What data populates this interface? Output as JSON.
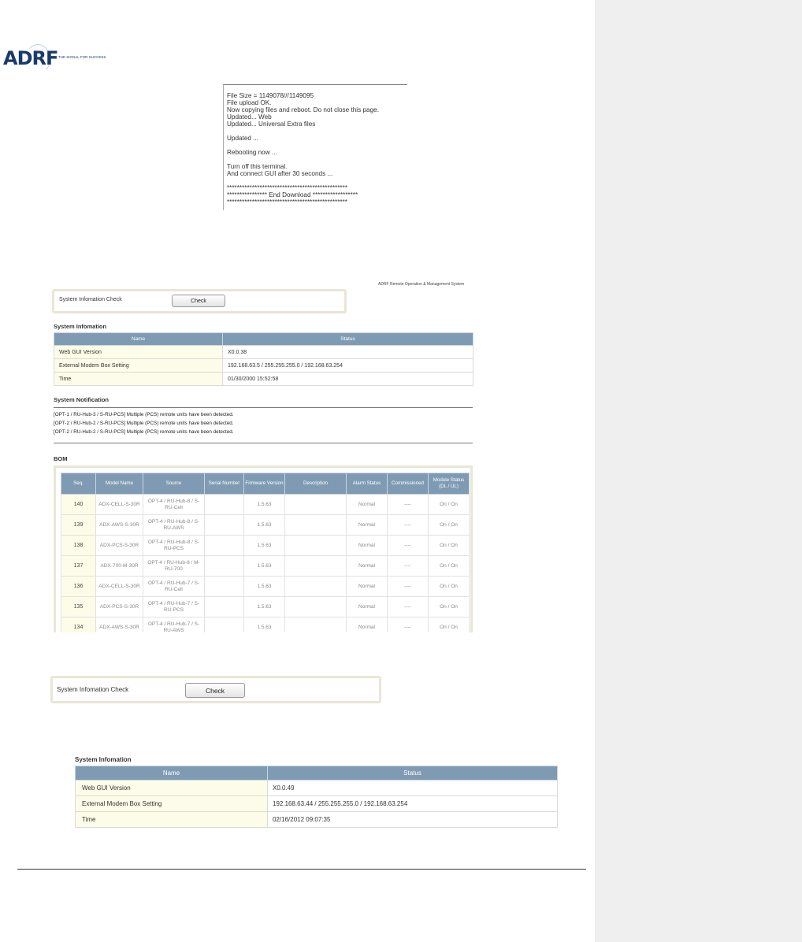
{
  "logo": {
    "brand": "ADRF",
    "tagline": "THE SIGNAL FOR SUCCESS"
  },
  "log": [
    "File Size = 1149078///1149095",
    "File upload OK.",
    "Now copying files and reboot. Do not close this page.",
    "Updated... Web",
    "Updated... Universal Extra files",
    "",
    "Updated ...",
    "",
    "Rebooting now ...",
    "",
    "Turn off this terminal.",
    "And connect GUI after 30 seconds ...",
    "",
    "************************************************",
    "**************** End Download ******************",
    "************************************************"
  ],
  "screen1": {
    "header_right": "ADRF Remote Operation & Management System",
    "check_label": "System Infomation Check",
    "check_button": "Check",
    "sysinfo_title": "System Infomation",
    "col_name": "Name",
    "col_status": "Status",
    "rows": [
      {
        "name": "Web GUI Version",
        "status": "X0.0.38"
      },
      {
        "name": "External Modem Box Setting",
        "status": "192.168.63.5 / 255.255.255.0 / 192.168.63.254"
      },
      {
        "name": "Time",
        "status": "01/30/2000 15:52:58"
      }
    ],
    "notification_title": "System Notification",
    "notifications": [
      "[OPT-1 / RU-Hub-3 / S-RU-PCS] Multiple (PCS) remote units have been detected.",
      "[OPT-2 / RU-Hub-2 / S-RU-PCS] Multiple (PCS) remote units have been detected.",
      "[OPT-2 / RU-Hub-2 / S-RU-PCS] Multiple (PCS) remote units have been detected."
    ],
    "bom_title": "BOM",
    "bom_headers": [
      "Seq.",
      "Model Name",
      "Source",
      "Serial Number",
      "Firmware Version",
      "Description",
      "Alarm Status",
      "Commissioned",
      "Module Status (DL / UL)"
    ],
    "bom_rows": [
      {
        "seq": "140",
        "model": "ADX-CELL-S-30R",
        "source": "OPT-4 / RU-Hub-8 / S-RU-Cell",
        "serial": "",
        "fw": "1.5.63",
        "desc": "",
        "alarm": "Normal",
        "comm": "----",
        "module": "On / On"
      },
      {
        "seq": "139",
        "model": "ADX-AWS-S-30R",
        "source": "OPT-4 / RU-Hub-8 / S-RU-AWS",
        "serial": "",
        "fw": "1.5.63",
        "desc": "",
        "alarm": "Normal",
        "comm": "----",
        "module": "On / On"
      },
      {
        "seq": "138",
        "model": "ADX-PCS-S-30R",
        "source": "OPT-4 / RU-Hub-8 / S-RU-PCS",
        "serial": "",
        "fw": "1.5.63",
        "desc": "",
        "alarm": "Normal",
        "comm": "----",
        "module": "On / On"
      },
      {
        "seq": "137",
        "model": "ADX-700-M-30R",
        "source": "OPT-4 / RU-Hub-8 / M-RU-700",
        "serial": "",
        "fw": "1.5.63",
        "desc": "",
        "alarm": "Normal",
        "comm": "----",
        "module": "On / On"
      },
      {
        "seq": "136",
        "model": "ADX-CELL-S-30R",
        "source": "OPT-4 / RU-Hub-7 / S-RU-Cell",
        "serial": "",
        "fw": "1.5.63",
        "desc": "",
        "alarm": "Normal",
        "comm": "----",
        "module": "On / On"
      },
      {
        "seq": "135",
        "model": "ADX-PCS-S-30R",
        "source": "OPT-4 / RU-Hub-7 / S-RU-PCS",
        "serial": "",
        "fw": "1.5.63",
        "desc": "",
        "alarm": "Normal",
        "comm": "----",
        "module": "On / On"
      },
      {
        "seq": "134",
        "model": "ADX-AWS-S-30R",
        "source": "OPT-4 / RU-Hub-7 / S-RU-AWS",
        "serial": "",
        "fw": "1.5.63",
        "desc": "",
        "alarm": "Normal",
        "comm": "----",
        "module": "On / On"
      }
    ]
  },
  "screen2": {
    "check_label": "System Infomation Check",
    "check_button": "Check"
  },
  "screen3": {
    "sysinfo_title": "System Infomation",
    "col_name": "Name",
    "col_status": "Status",
    "rows": [
      {
        "name": "Web GUI Version",
        "status": "X0.0.49"
      },
      {
        "name": "External Modem Box Setting",
        "status": "192.168.63.44 / 255.255.255.0 / 192.168.63.254"
      },
      {
        "name": "Time",
        "status": "02/16/2012 09:07:35"
      }
    ]
  }
}
